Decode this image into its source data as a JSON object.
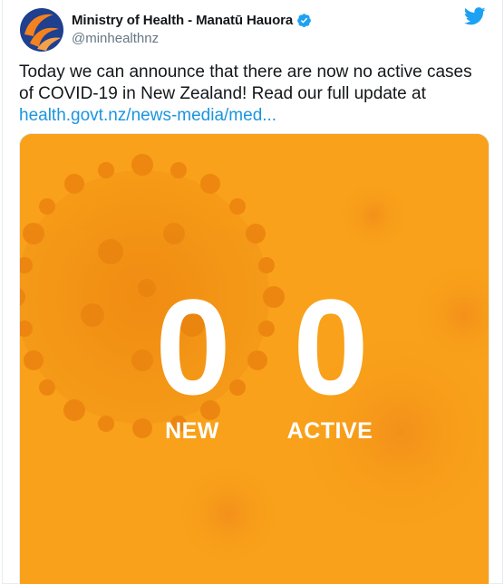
{
  "author": {
    "name": "Ministry of Health - Manatū Hauora",
    "handle": "@minhealthnz",
    "avatar_icon": "ministry-of-health-logo",
    "verified_icon": "verified-badge-icon"
  },
  "platform_icon": "twitter-bird-icon",
  "tweet": {
    "text": "Today we can announce that there are now no active cases of COVID-19 in New Zealand! Read our full update at",
    "link": "health.govt.nz/news-media/med..."
  },
  "media": {
    "background_color": "#f9a11a",
    "stats": [
      {
        "value": "0",
        "label": "NEW"
      },
      {
        "value": "0",
        "label": "ACTIVE"
      }
    ]
  },
  "colors": {
    "link": "#1b95e0",
    "twitter_blue": "#1da1f2",
    "orange": "#f9a11a"
  }
}
